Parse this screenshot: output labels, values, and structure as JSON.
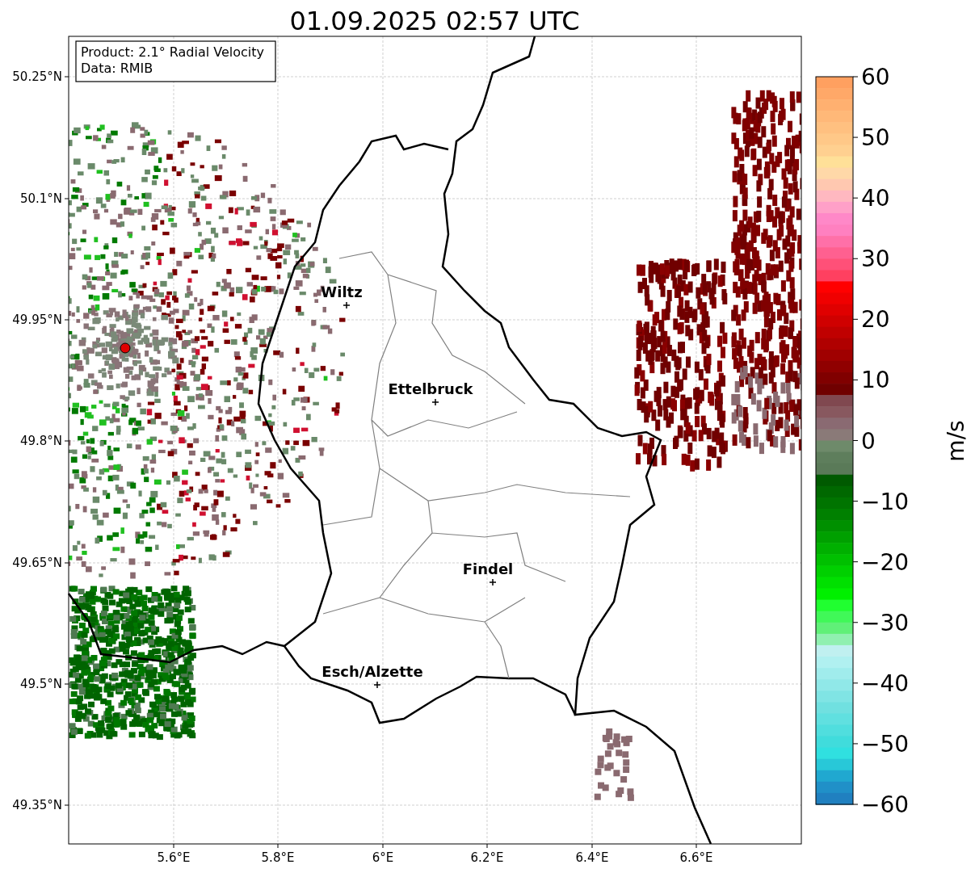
{
  "title": "01.09.2025 02:57 UTC",
  "info_box": {
    "lines": [
      "Product: 2.1° Radial Velocity",
      "Data: RMIB"
    ]
  },
  "x_ticks": [
    "5.6°E",
    "5.8°E",
    "6°E",
    "6.2°E",
    "6.4°E",
    "6.6°E"
  ],
  "y_ticks": [
    "50.25°N",
    "50.1°N",
    "49.95°N",
    "49.8°N",
    "49.65°N",
    "49.5°N",
    "49.35°N"
  ],
  "cities": [
    {
      "name": "Wiltz"
    },
    {
      "name": "Ettelbruck"
    },
    {
      "name": "Findel"
    },
    {
      "name": "Esch/Alzette"
    }
  ],
  "colorbar": {
    "label": "m/s",
    "ticks": [
      "60",
      "50",
      "40",
      "30",
      "20",
      "10",
      "0",
      "−10",
      "−20",
      "−30",
      "−40",
      "−50",
      "−60"
    ]
  }
}
